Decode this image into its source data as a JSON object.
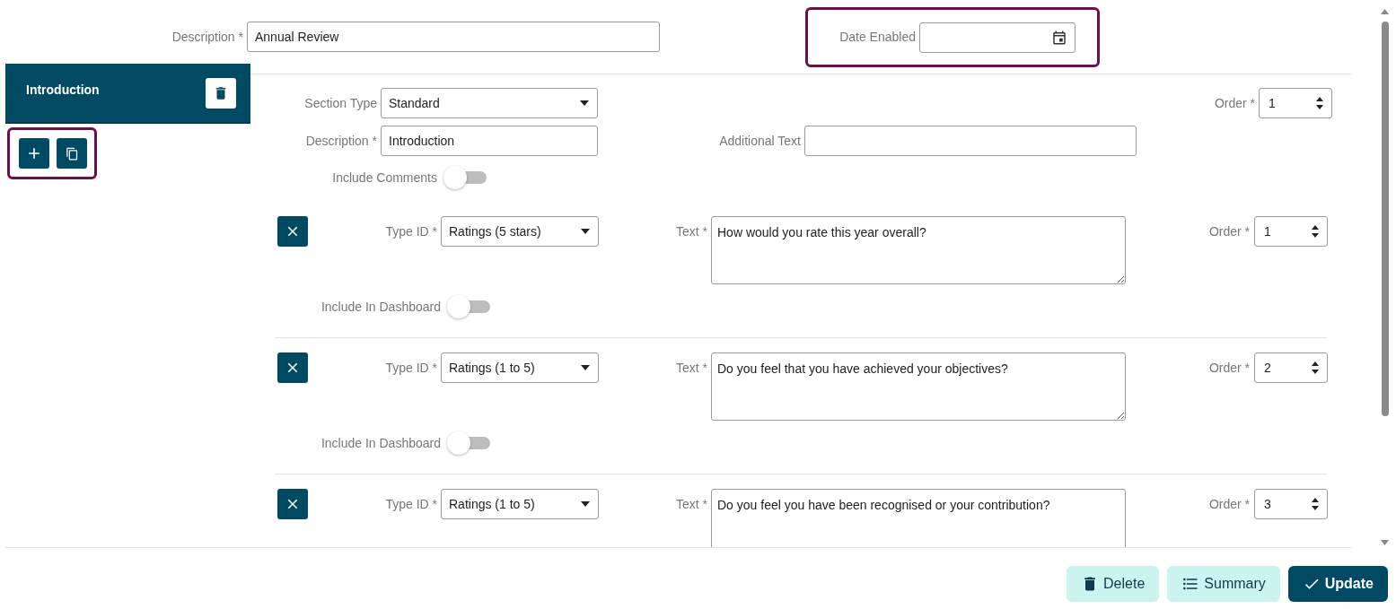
{
  "form": {
    "description": {
      "label": "Description *",
      "value": "Annual Review"
    },
    "date_enabled": {
      "label": "Date Enabled"
    }
  },
  "sections": [
    {
      "title": "Introduction",
      "selected": true
    }
  ],
  "section": {
    "section_type": {
      "label": "Section Type",
      "value": "Standard"
    },
    "order": {
      "label": "Order *",
      "value": "1"
    },
    "description": {
      "label": "Description *",
      "value": "Introduction"
    },
    "additional_text": {
      "label": "Additional Text"
    },
    "include_comments": {
      "label": "Include Comments",
      "on": false
    }
  },
  "questions": [
    {
      "type_id": {
        "label": "Type ID *",
        "value": "Ratings (5 stars)"
      },
      "text": {
        "label": "Text *",
        "value": "How would you rate this year overall?"
      },
      "order": {
        "label": "Order *",
        "value": "1"
      },
      "include_in_dashboard": {
        "label": "Include In Dashboard",
        "on": false
      }
    },
    {
      "type_id": {
        "label": "Type ID *",
        "value": "Ratings (1 to 5)"
      },
      "text": {
        "label": "Text *",
        "value": "Do you feel that you have achieved your objectives?"
      },
      "order": {
        "label": "Order *",
        "value": "2"
      },
      "include_in_dashboard": {
        "label": "Include In Dashboard",
        "on": false
      }
    },
    {
      "type_id": {
        "label": "Type ID *",
        "value": "Ratings (1 to 5)"
      },
      "text": {
        "label": "Text *",
        "value": "Do you feel you have been recognised or your contribution?"
      },
      "order": {
        "label": "Order *",
        "value": "3"
      }
    }
  ],
  "actions": [
    {
      "label": "Delete",
      "kind": "delete"
    },
    {
      "label": "Summary",
      "kind": "summary"
    },
    {
      "label": "Update",
      "kind": "update"
    }
  ]
}
